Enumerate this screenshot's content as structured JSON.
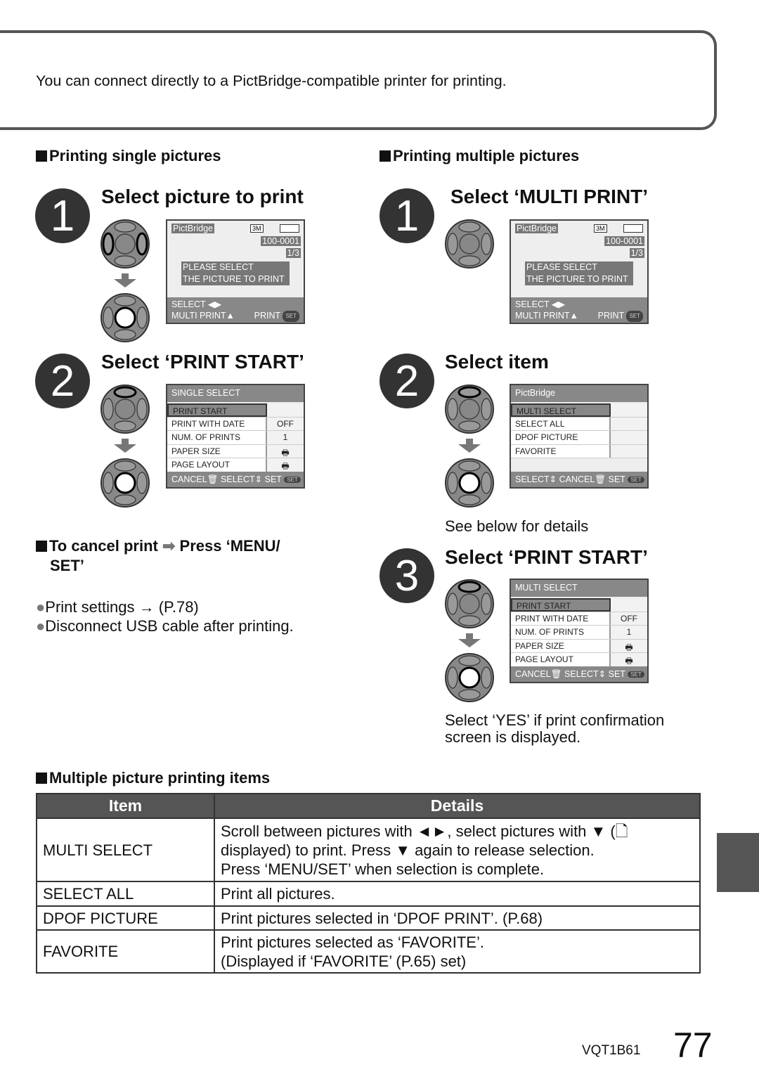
{
  "intro": "You can connect directly to a PictBridge-compatible printer for printing.",
  "single": {
    "heading": "Printing single pictures",
    "step1": {
      "num": "1",
      "title": "Select picture to print"
    },
    "step2": {
      "num": "2",
      "title": "Select ‘PRINT START’"
    },
    "cancel": {
      "text": "To cancel print",
      "press": "Press ‘MENU/",
      "press2": "SET’"
    },
    "notes": [
      "Print settings → (P.78)",
      "Disconnect USB cable after printing."
    ]
  },
  "multiple": {
    "heading": "Printing multiple pictures",
    "step1": {
      "num": "1",
      "title": "Select ‘MULTI PRINT’"
    },
    "step2": {
      "num": "2",
      "title": "Select item",
      "note": "See below for details"
    },
    "step3": {
      "num": "3",
      "title": "Select ‘PRINT START’",
      "note1": "Select ‘YES’ if print confirmation",
      "note2": "screen is displayed."
    }
  },
  "lcd_pict": {
    "brand": "PictBridge",
    "size": "3M",
    "file": "100-0001",
    "count": "1/3",
    "msg1": "PLEASE SELECT",
    "msg2": "THE PICTURE TO PRINT",
    "select": "SELECT ◀▶",
    "multi": "MULTI PRINT▲",
    "print": "PRINT",
    "set": "SET"
  },
  "lcd_single": {
    "header": "SINGLE SELECT",
    "rows": [
      {
        "k": "PRINT START",
        "v": ""
      },
      {
        "k": "PRINT WITH DATE",
        "v": "OFF"
      },
      {
        "k": "NUM. OF PRINTS",
        "v": "1"
      },
      {
        "k": "PAPER SIZE",
        "v": "🖶"
      },
      {
        "k": "PAGE LAYOUT",
        "v": "🖶"
      }
    ],
    "footer": "CANCEL🗑 SELECT⇕ SET"
  },
  "lcd_item": {
    "header": "PictBridge",
    "rows": [
      {
        "k": "MULTI SELECT",
        "v": ""
      },
      {
        "k": "SELECT ALL",
        "v": ""
      },
      {
        "k": "DPOF PICTURE",
        "v": ""
      },
      {
        "k": "FAVORITE",
        "v": ""
      }
    ],
    "footer": "SELECT⇕ CANCEL🗑 SET"
  },
  "lcd_multi": {
    "header": "MULTI SELECT",
    "rows": [
      {
        "k": "PRINT START",
        "v": ""
      },
      {
        "k": "PRINT WITH DATE",
        "v": "OFF"
      },
      {
        "k": "NUM. OF PRINTS",
        "v": "1"
      },
      {
        "k": "PAPER SIZE",
        "v": "🖶"
      },
      {
        "k": "PAGE LAYOUT",
        "v": "🖶"
      }
    ],
    "footer": "CANCEL🗑 SELECT⇕ SET"
  },
  "table": {
    "heading": "Multiple picture printing items",
    "headers": [
      "Item",
      "Details"
    ],
    "rows": [
      {
        "item": "MULTI SELECT",
        "details": [
          "Scroll between pictures with ◄►, select pictures with ▼ (🗋",
          "displayed) to print. Press ▼ again to release selection.",
          "Press ‘MENU/SET’ when selection is complete."
        ]
      },
      {
        "item": "SELECT ALL",
        "details": [
          "Print all pictures."
        ]
      },
      {
        "item": "DPOF PICTURE",
        "details": [
          "Print pictures selected in ‘DPOF PRINT’. (P.68)"
        ]
      },
      {
        "item": "FAVORITE",
        "details": [
          "Print pictures selected as ‘FAVORITE’.",
          "(Displayed if ‘FAVORITE’ (P.65) set)"
        ]
      }
    ]
  },
  "footer": {
    "code": "VQT1B61",
    "page": "77"
  }
}
